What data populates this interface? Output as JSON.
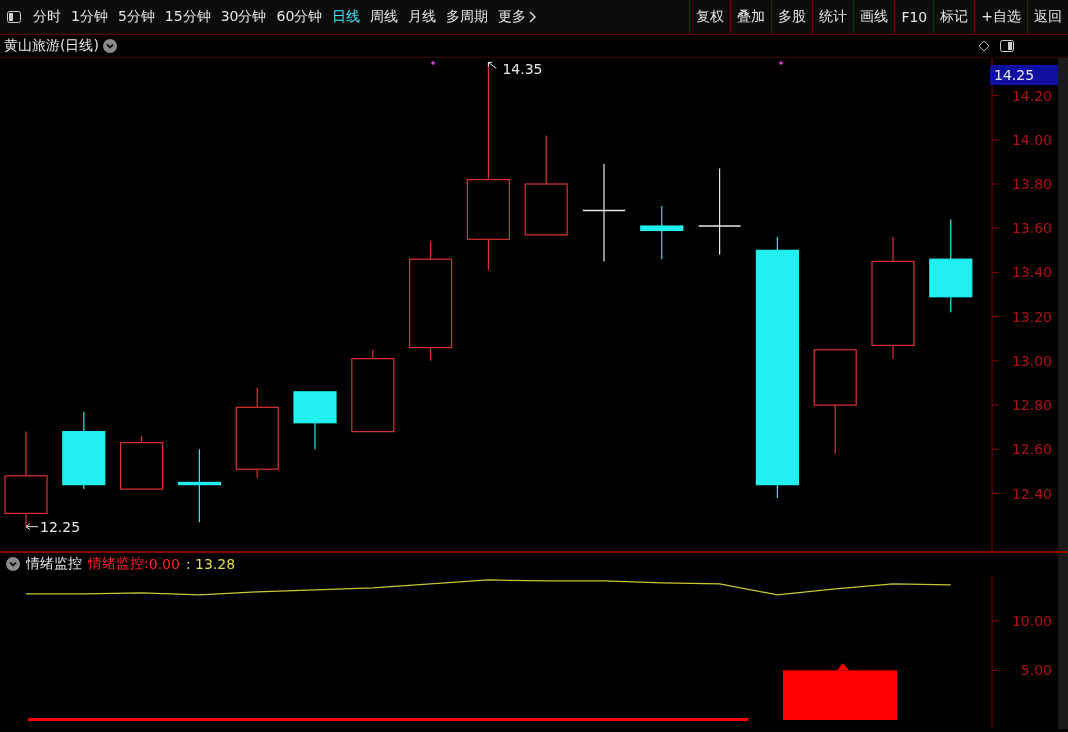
{
  "toolbar": {
    "periods": [
      {
        "label": "分时",
        "selected": false
      },
      {
        "label": "1分钟",
        "selected": false
      },
      {
        "label": "5分钟",
        "selected": false
      },
      {
        "label": "15分钟",
        "selected": false
      },
      {
        "label": "30分钟",
        "selected": false
      },
      {
        "label": "60分钟",
        "selected": false
      },
      {
        "label": "日线",
        "selected": true
      },
      {
        "label": "周线",
        "selected": false
      },
      {
        "label": "月线",
        "selected": false
      },
      {
        "label": "多周期",
        "selected": false
      }
    ],
    "more": "更多",
    "buttons": [
      "复权",
      "叠加",
      "多股",
      "统计",
      "画线",
      "F10",
      "标记",
      "+自选",
      "返回"
    ]
  },
  "chart_title": "黄山旅游(日线)",
  "price_badge": "14.25",
  "main_chart": {
    "y_axis": [
      "14.20",
      "14.00",
      "13.80",
      "13.60",
      "13.40",
      "13.20",
      "13.00",
      "12.80",
      "12.60",
      "12.40"
    ],
    "high_label": "14.35",
    "low_label": "12.25"
  },
  "indicator": {
    "name": "情绪监控",
    "label": "情绪监控:",
    "value": "0.00",
    "line_reading": ": 13.28",
    "y_axis": [
      "10.00",
      "5.00"
    ]
  }
}
